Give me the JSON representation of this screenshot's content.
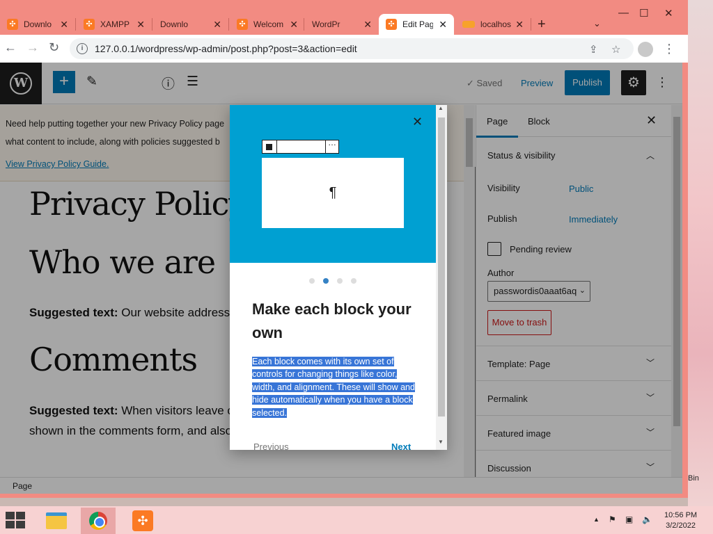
{
  "browser": {
    "tabs": [
      {
        "label": "Downlo",
        "icon": "xampp-icon",
        "active": false
      },
      {
        "label": "XAMPP",
        "icon": "xampp-icon",
        "active": false
      },
      {
        "label": "Downlo",
        "icon": "wordpress-icon",
        "active": false
      },
      {
        "label": "Welcom",
        "icon": "xampp-icon",
        "active": false
      },
      {
        "label": "WordPr",
        "icon": "wordpress-icon",
        "active": false
      },
      {
        "label": "Edit Pag",
        "icon": "xampp-icon",
        "active": true
      },
      {
        "label": "localhos",
        "icon": "phpmyadmin-icon",
        "active": false
      }
    ],
    "new_tab": "+",
    "url": "127.0.0.1/wordpress/wp-admin/post.php?post=3&action=edit"
  },
  "editor": {
    "saved_label": "Saved",
    "preview_label": "Preview",
    "publish_label": "Publish",
    "notice": {
      "line1": "Need help putting together your new Privacy Policy page",
      "line2": "what content to include, along with policies suggested b",
      "link": "View Privacy Policy Guide."
    },
    "title": "Privacy Policy",
    "heading_who": "Who we are",
    "p1_bold": "Suggested text:",
    "p1_text": " Our website address",
    "heading_comments": "Comments",
    "p2_bold": "Suggested text:",
    "p2_text": " When visitors leave comments on the site we collect the data shown in the comments form, and also the visitor’s IP address",
    "status_label": "Page"
  },
  "sidebar": {
    "tab_page": "Page",
    "tab_block": "Block",
    "status_heading": "Status & visibility",
    "visibility_label": "Visibility",
    "visibility_value": "Public",
    "publish_label": "Publish",
    "publish_value": "Immediately",
    "pending_review": "Pending review",
    "author_label": "Author",
    "author_value": "passwordis0aaat6aq",
    "move_to_trash": "Move to trash",
    "panels": [
      "Template: Page",
      "Permalink",
      "Featured image",
      "Discussion"
    ]
  },
  "guide_modal": {
    "heading": "Make each block your own",
    "body": "Each block comes with its own set of controls for changing things like color, width, and alignment. These will show and hide automatically when you have a block selected.",
    "previous": "Previous",
    "next": "Next",
    "page_index": 2,
    "page_count": 4,
    "illustration_glyph": "¶"
  },
  "taskbar": {
    "apps": [
      "file-explorer-icon",
      "chrome-icon",
      "xampp-icon"
    ],
    "time": "10:56 PM",
    "date": "3/2/2022"
  },
  "desktop": {
    "recycle_bin_label": "Bin"
  },
  "colors": {
    "accent": "#007cba",
    "hero": "#00a0d2",
    "trash": "#cc1818",
    "browser_frame": "#f28b82"
  }
}
